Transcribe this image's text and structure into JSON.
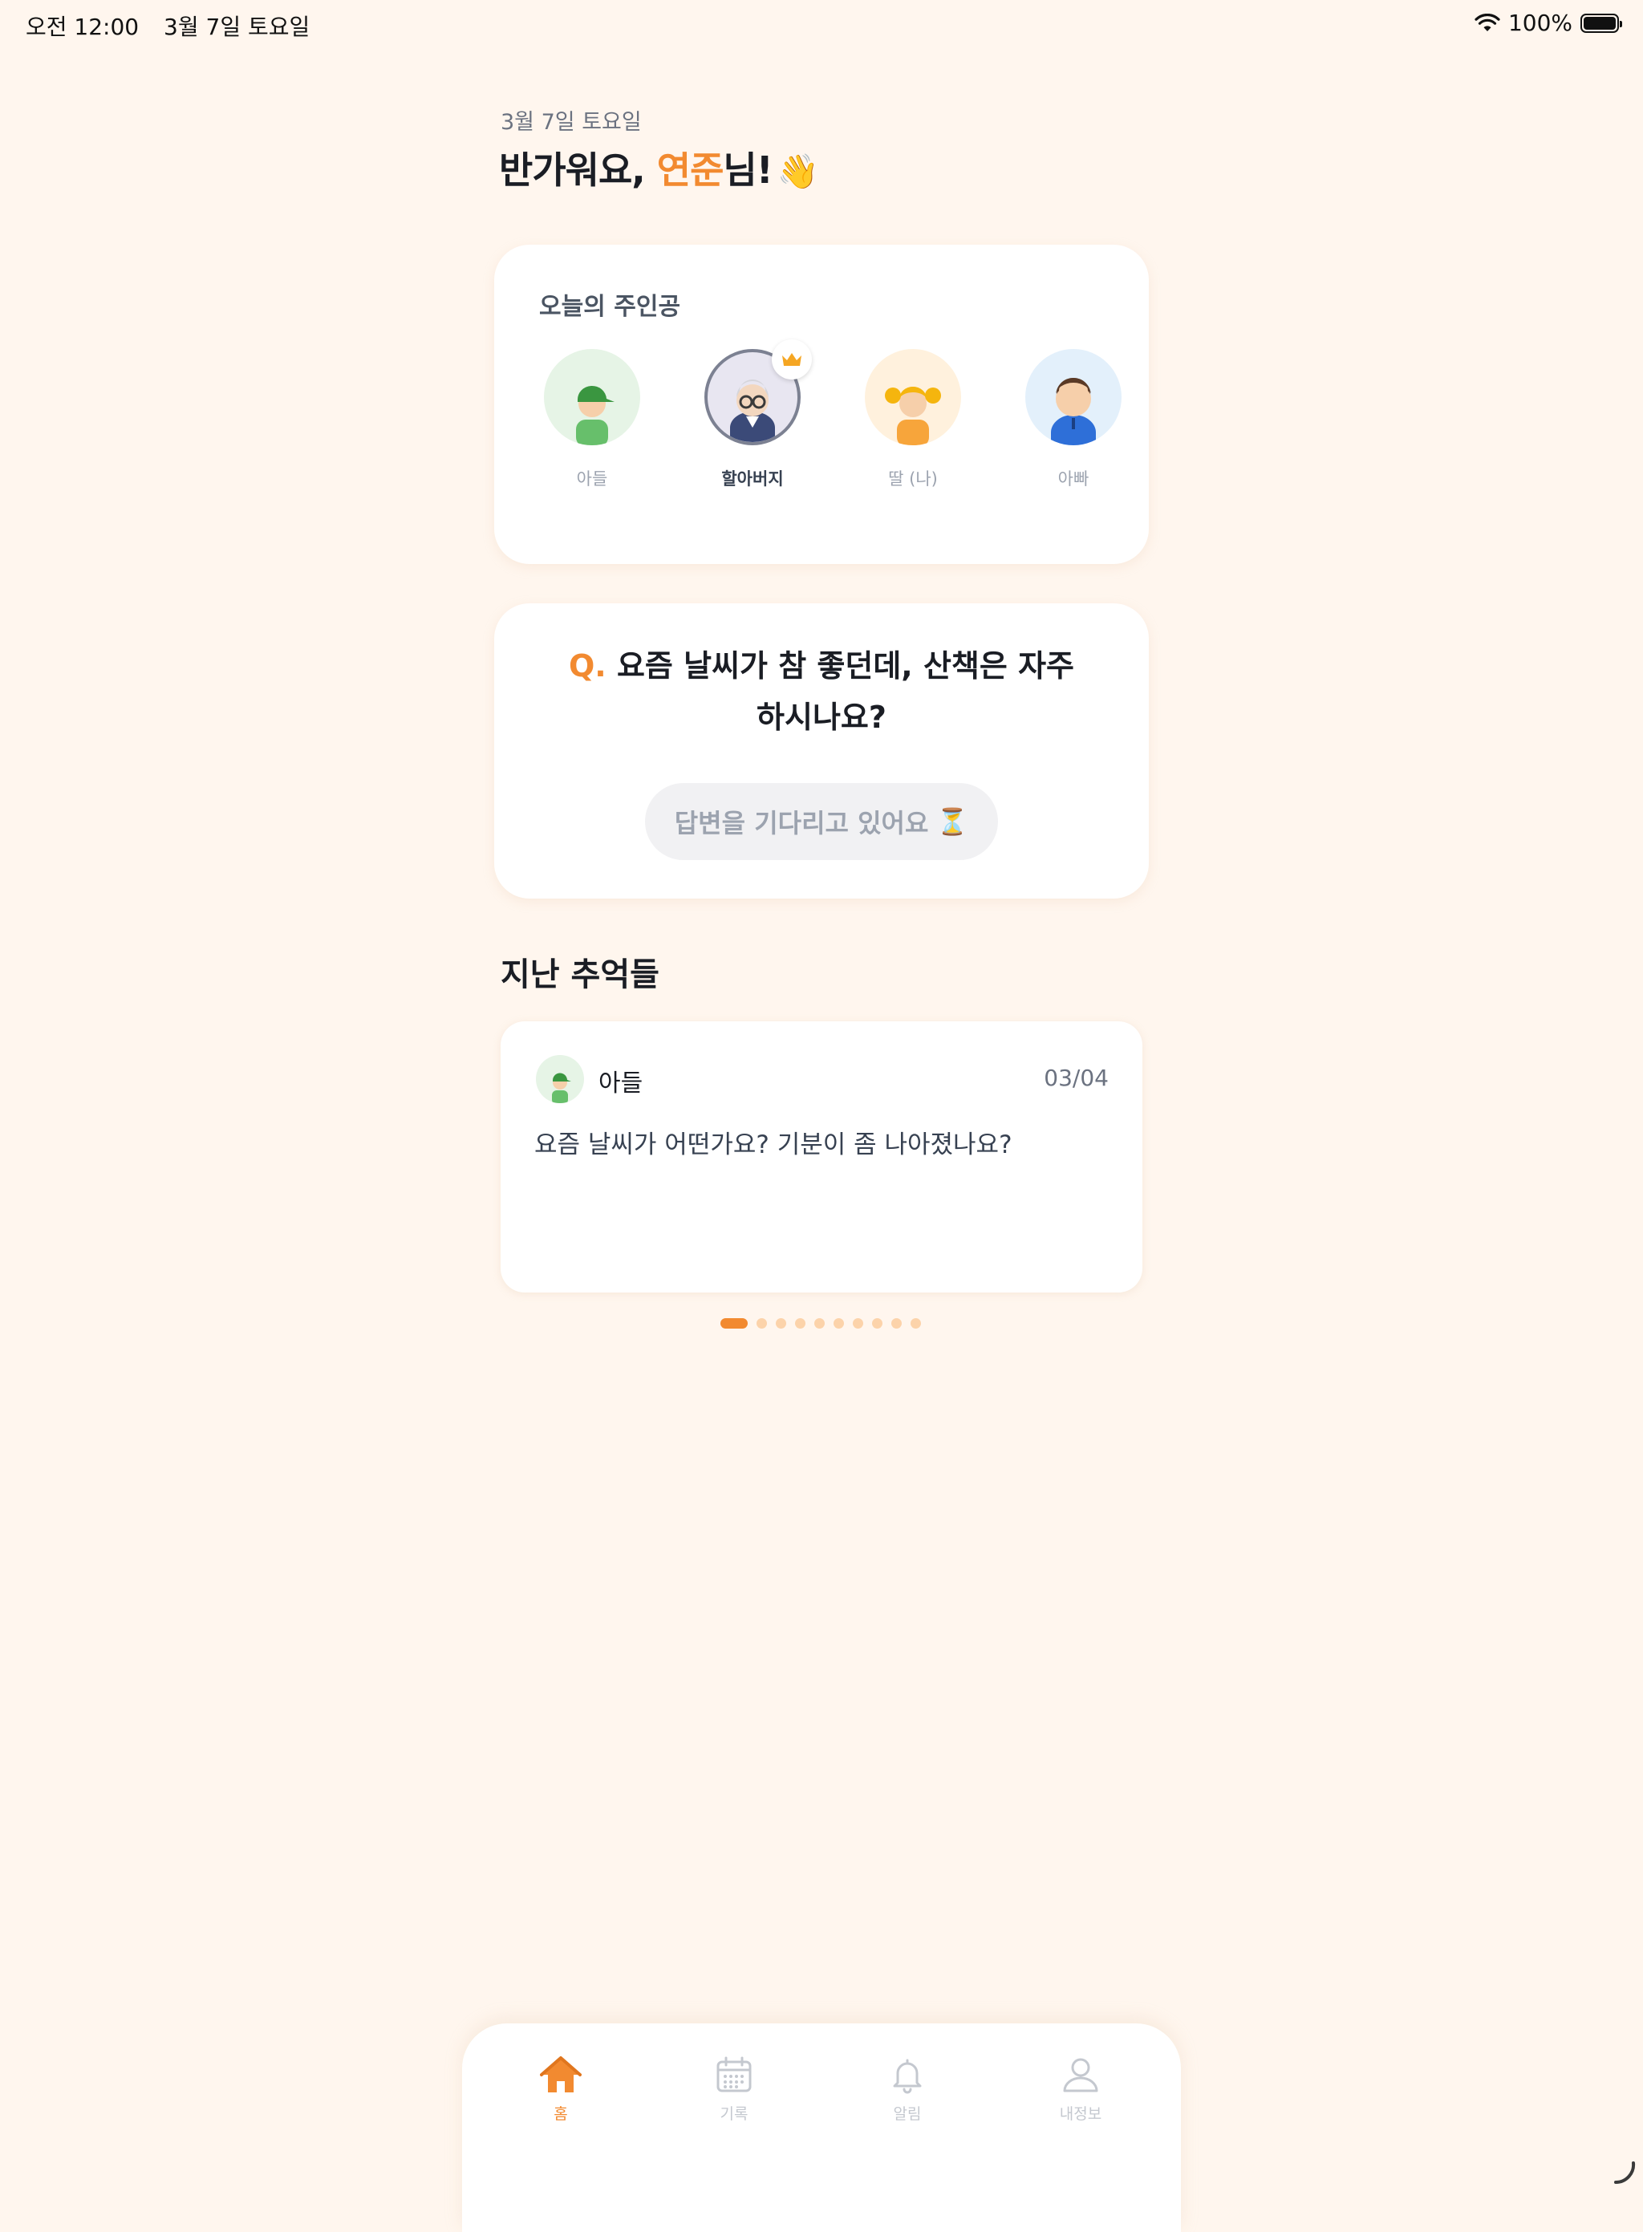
{
  "status_bar": {
    "time": "오전 12:00",
    "date": "3월 7일 토요일",
    "battery": "100%",
    "icons": [
      "wifi-icon",
      "battery-icon"
    ]
  },
  "header": {
    "date": "3월 7일 토요일",
    "greeting_prefix": "반가워요, ",
    "user_name": "연준",
    "greeting_suffix": "님!",
    "emoji": "👋"
  },
  "hero": {
    "title": "오늘의 주인공",
    "members": [
      {
        "label": "아들",
        "active": false,
        "bg": "#E6F4E6"
      },
      {
        "label": "할아버지",
        "active": true,
        "bg": "#E8E6F1"
      },
      {
        "label": "딸 (나)",
        "active": false,
        "bg": "#FFF1DD"
      },
      {
        "label": "아빠",
        "active": false,
        "bg": "#E3F0FB"
      }
    ]
  },
  "question": {
    "prefix": "Q.",
    "line1": "요즘 날씨가 참 좋던데, 산책은 자주",
    "line2": "하시나요?",
    "waiting_label": "답변을 기다리고 있어요",
    "waiting_emoji": "⏳"
  },
  "memories": {
    "section_title": "지난 추억들",
    "items": [
      {
        "author": "아들",
        "date": "03/04",
        "text": "요즘 날씨가 어떤가요? 기분이 좀 나아졌나요?"
      }
    ],
    "page_count": 10,
    "current_page": 1
  },
  "tabs": [
    {
      "label": "홈",
      "icon": "home-icon",
      "active": true
    },
    {
      "label": "기록",
      "icon": "calendar-icon",
      "active": false
    },
    {
      "label": "알림",
      "icon": "bell-icon",
      "active": false
    },
    {
      "label": "내정보",
      "icon": "user-icon",
      "active": false
    }
  ],
  "colors": {
    "accent": "#F28A30",
    "background": "#FFF6EE",
    "card": "#FFFFFF"
  }
}
